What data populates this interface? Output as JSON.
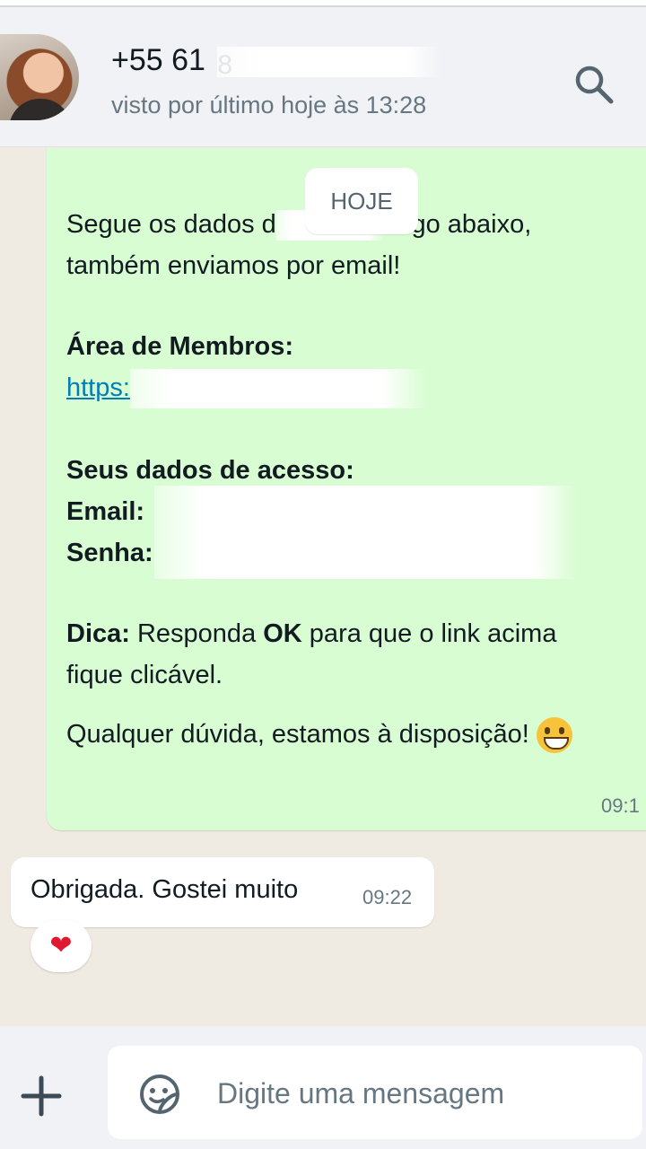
{
  "header": {
    "contact_name": "+55 61",
    "contact_name_obscured": "8",
    "last_seen": "visto por último hoje às 13:28"
  },
  "chat": {
    "date_chip": "HOJE",
    "outgoing": {
      "line1_a": "Segue os dados d",
      "line1_b": " logo abaixo,",
      "line2": "também enviamos por email!",
      "members_label": "Área de Membros:",
      "link": "https:",
      "access_label": "Seus dados de acesso:",
      "email_label": "Email:",
      "password_label": "Senha:",
      "tip_label": "Dica:",
      "tip_a": " Responda ",
      "tip_ok": "OK",
      "tip_b": " para que o link acima",
      "tip_line2": "fique clicável.",
      "closing": "Qualquer dúvida, estamos à disposição!",
      "time": "09:1"
    },
    "incoming": {
      "text": "Obrigada. Gostei muito",
      "time": "09:22",
      "reaction": "❤"
    }
  },
  "footer": {
    "input_placeholder": "Digite uma mensagem"
  }
}
